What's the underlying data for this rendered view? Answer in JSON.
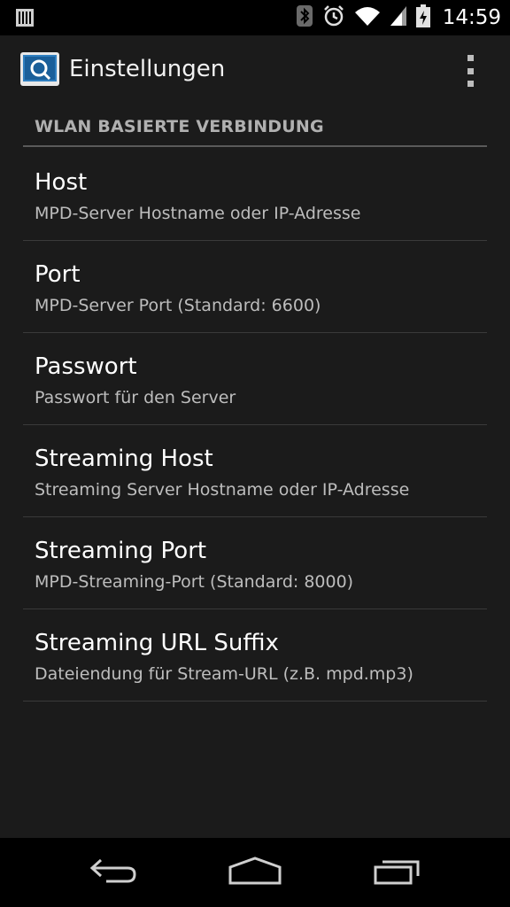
{
  "status_bar": {
    "time": "14:59",
    "icons": [
      "sim-card-icon",
      "bluetooth-icon",
      "alarm-icon",
      "wifi-icon",
      "signal-icon",
      "battery-icon"
    ]
  },
  "action_bar": {
    "title": "Einstellungen",
    "icon": "app-icon",
    "overflow_icon": "overflow-menu-icon"
  },
  "category": {
    "label": "WLAN BASIERTE VERBINDUNG"
  },
  "preferences": [
    {
      "title": "Host",
      "summary": "MPD-Server Hostname oder IP-Adresse"
    },
    {
      "title": "Port",
      "summary": "MPD-Server Port (Standard: 6600)"
    },
    {
      "title": "Passwort",
      "summary": "Passwort für den Server"
    },
    {
      "title": "Streaming Host",
      "summary": "Streaming Server Hostname oder IP-Adresse"
    },
    {
      "title": "Streaming Port",
      "summary": "MPD-Streaming-Port (Standard: 8000)"
    },
    {
      "title": "Streaming URL Suffix",
      "summary": "Dateiendung für Stream-URL (z.B. mpd.mp3)"
    }
  ],
  "nav_bar": {
    "buttons": [
      "back-icon",
      "home-icon",
      "recent-apps-icon"
    ]
  },
  "colors": {
    "background": "#1b1b1b",
    "status_bar": "#000000",
    "divider": "#3a3a3a",
    "category_text": "#b0b0b0",
    "summary_text": "#bdbdbd",
    "accent_icon": "#2f7fc0"
  }
}
